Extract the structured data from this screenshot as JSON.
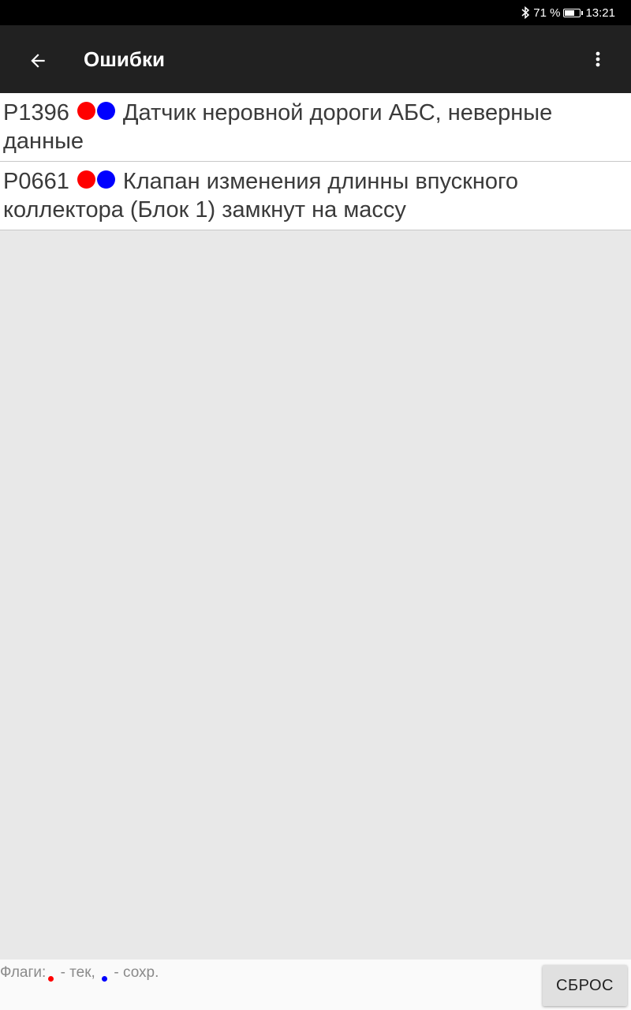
{
  "status_bar": {
    "icons": [
      "bluetooth-icon",
      "battery-icon"
    ],
    "battery": "71 %",
    "battery_level": 0.71,
    "time": "13:21"
  },
  "app_bar": {
    "title": "Ошибки",
    "icons": [
      "back-arrow-icon",
      "more-vert-icon"
    ]
  },
  "errors": [
    {
      "code": "P1396",
      "flag_colors": [
        "#ff0000",
        "#0000ff"
      ],
      "description": "Датчик неровной дороги АБС, неверные данные"
    },
    {
      "code": "P0661",
      "flag_colors": [
        "#ff0000",
        "#0000ff"
      ],
      "description": "Клапан изменения длинны впускного коллектора (Блок 1) замкнут на массу"
    }
  ],
  "footer": {
    "legend_label": "Флаги:",
    "current_flag_text": " - тек, ",
    "current_flag_color": "#ff0000",
    "saved_flag_text": " - сохр.",
    "saved_flag_color": "#0000ff",
    "reset_button": "СБРОС"
  }
}
